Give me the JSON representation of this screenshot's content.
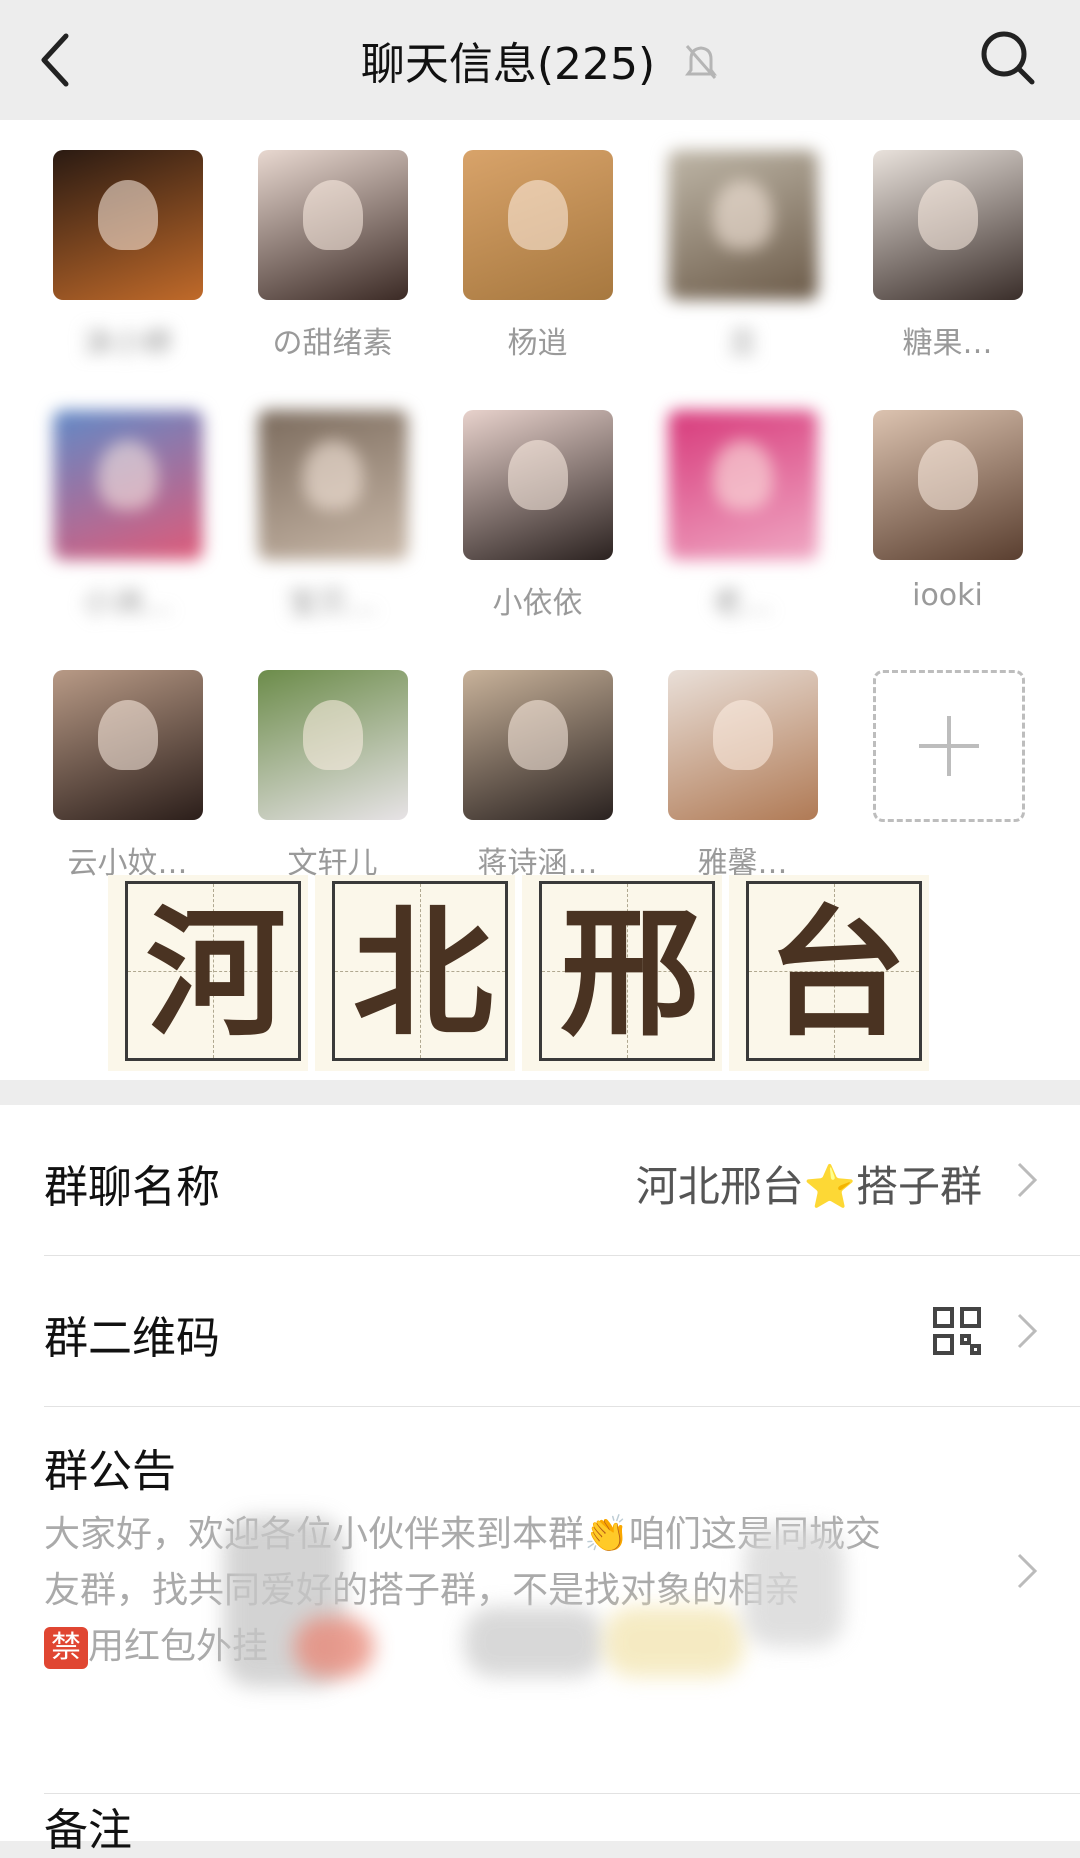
{
  "header": {
    "title": "聊天信息(225)"
  },
  "members": [
    {
      "name": "沫小婷",
      "colors": [
        "#2a1a12",
        "#c06a2a"
      ],
      "blurred_name": true
    },
    {
      "name": "の甜绪素",
      "colors": [
        "#e8d8d0",
        "#3b2a25"
      ],
      "blurred_name": false
    },
    {
      "name": "杨逍",
      "colors": [
        "#d8a36a",
        "#a7783f"
      ],
      "blurred_name": false
    },
    {
      "name": "旦",
      "colors": [
        "#bfb7a8",
        "#6b5a48"
      ],
      "blurred_name": true
    },
    {
      "name": "糖果…",
      "colors": [
        "#e9e2dc",
        "#3a2e2a"
      ],
      "blurred_name": false
    },
    {
      "name": "小洲…",
      "colors": [
        "#5f8ac8",
        "#e05a78"
      ],
      "blurred_name": true
    },
    {
      "name": "宝贝…",
      "colors": [
        "#7a6a5c",
        "#c9b8a8"
      ],
      "blurred_name": true
    },
    {
      "name": "小依依",
      "colors": [
        "#e8d2cc",
        "#2b2220"
      ],
      "blurred_name": false
    },
    {
      "name": "老…",
      "colors": [
        "#d7387a",
        "#f0a9c4"
      ],
      "blurred_name": true
    },
    {
      "name": "iooki",
      "colors": [
        "#dcc3b0",
        "#5a3f30"
      ],
      "blurred_name": false
    },
    {
      "name": "云小妏…",
      "colors": [
        "#b89a86",
        "#2b1e1a"
      ],
      "blurred_name": false
    },
    {
      "name": "文轩儿",
      "colors": [
        "#6c8c4a",
        "#e7e3e6"
      ],
      "blurred_name": false
    },
    {
      "name": "蒋诗涵…",
      "colors": [
        "#c8b29a",
        "#2a2220"
      ],
      "blurred_name": false
    },
    {
      "name": "雅馨…",
      "colors": [
        "#e9dfd8",
        "#b07a55"
      ],
      "blurred_name": false
    }
  ],
  "banner_chars": [
    "河",
    "北",
    "邢",
    "台"
  ],
  "settings": {
    "group_name_label": "群聊名称",
    "group_name_value": "河北邢台⭐搭子群",
    "qr_label": "群二维码",
    "notice_label": "群公告",
    "notice_line1": "大家好，欢迎各位小伙伴来到本群👏咱们这是同城交",
    "notice_line2": "友群，找共同爱好的搭子群，不是找对象的相亲",
    "notice_badge": "禁",
    "notice_line3": "用红包外挂",
    "remark_label": "备注"
  },
  "colors": {
    "header_bg": "#ededed",
    "banner_text": "#4a3322",
    "forbidden_badge": "#e04632"
  }
}
